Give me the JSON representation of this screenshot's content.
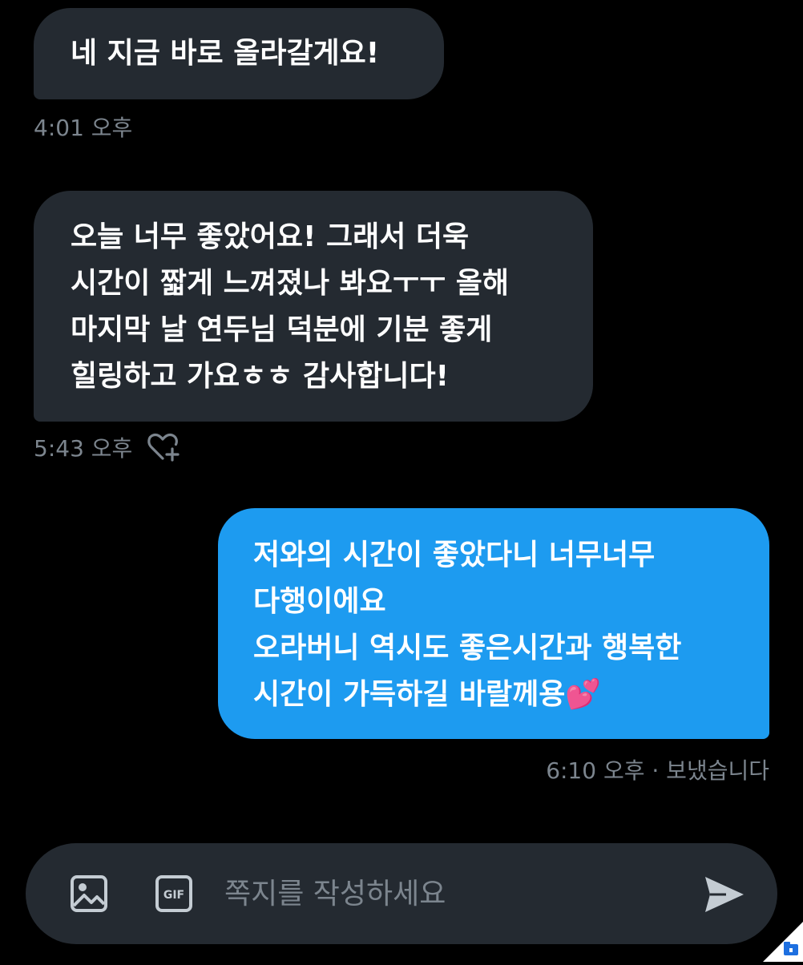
{
  "messages": [
    {
      "direction": "received",
      "lines": [
        "네 지금 바로 올라갈게요!"
      ],
      "time": "4:01 오후"
    },
    {
      "direction": "received",
      "lines": [
        "오늘 너무 좋았어요! 그래서 더욱",
        "시간이 짧게 느껴졌나 봐요ㅜㅜ 올해",
        "마지막 날 연두님 덕분에 기분 좋게",
        "힐링하고 가요ㅎㅎ 감사합니다!"
      ],
      "time": "5:43 오후",
      "like_icon": "heart-plus-icon"
    },
    {
      "direction": "sent",
      "lines": [
        "저와의 시간이 좋았다니 너무너무",
        "다행이에요",
        "오라버니 역시도 좋은시간과 행복한",
        "시간이 가득하길 바랄께용💕"
      ],
      "time": "6:10 오후 · 보냈습니다"
    }
  ],
  "composer": {
    "placeholder": "쪽지를 작성하세요",
    "value": "",
    "image_icon": "image-icon",
    "gif_icon": "gif-icon",
    "gif_label": "GIF",
    "send_icon": "send-icon"
  },
  "colors": {
    "background": "#000000",
    "received_bubble": "#242a31",
    "sent_bubble": "#1d9bf0",
    "meta_text": "#7c858e",
    "icon": "#c4ccd3"
  }
}
